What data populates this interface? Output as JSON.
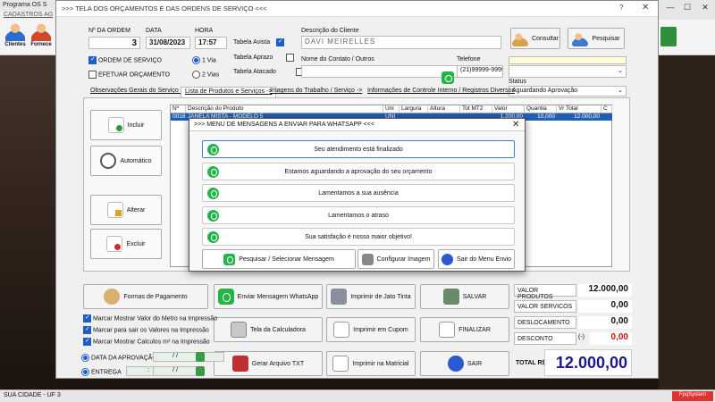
{
  "background_app": {
    "title": "Programa OS S",
    "menu": "CADASTROS   AG",
    "toolbar": [
      "Clientes",
      "Fornece"
    ],
    "status_left": "SUA CIDADE - UF 3",
    "brand": "FpqSystem"
  },
  "window": {
    "title": ">>>  TELA DOS ORÇAMENTOS E DAS ORDENS DE SERVIÇO  <<<",
    "help": "?",
    "close": "✕"
  },
  "order": {
    "num_label": "Nº DA ORDEM",
    "num": "3",
    "date_label": "DATA",
    "date": "31/08/2023",
    "time_label": "HORA",
    "time": "17:57"
  },
  "tables": {
    "avista": "Tabela Avista",
    "aprazo": "Tabela Aprazo",
    "atacado": "Tabela Atacado"
  },
  "type_options": {
    "ordem": "ORDEM DE SERVIÇO",
    "orcamento": "EFETUAR ORÇAMENTO",
    "via1": "1 Via",
    "via2": "2 Vias"
  },
  "client": {
    "desc_label": "Descrição do Cliente",
    "name": "DAVI MEIRELLES",
    "contact_label": "Nome do Contato / Outros",
    "contact": "",
    "phone_label": "Telefone",
    "phone": "(21)99999-9999",
    "consultar": "Consultar",
    "pesquisar": "Pesquisar"
  },
  "status": {
    "label": "Status",
    "value": "Aguardando Aprovação"
  },
  "tabs": [
    "Observações Gerais do Serviço ->",
    "Lista de Produtos e Serviços ->",
    "Imagens do Trabalho / Serviço ->",
    "Informações de Controle Interno / Registros Diversos"
  ],
  "side_buttons": {
    "incluir": "Incluir",
    "automatico": "Automático",
    "alterar": "Alterar",
    "excluir": "Excluir"
  },
  "grid": {
    "columns": [
      "Nº",
      "Descrição do Produto",
      "Uni",
      "Largura",
      "Altura",
      "Tot MT2",
      "Valor",
      "Quantia",
      "Vr Total",
      "C"
    ],
    "rows": [
      [
        "0016",
        "JANELA MISTA - MODELO 5",
        "UNI",
        "",
        "",
        "",
        "1.200,00",
        "10,000",
        "12.000,00",
        ""
      ]
    ]
  },
  "modal": {
    "title": ">>>  MENU DE MENSAGENS A ENVIAR PARA WHATSAPP  <<<",
    "close": "✕",
    "messages": [
      "Seu atendimento está finalizado",
      "Estamos aguardando a aprovação do seu orçamento",
      "Lamentamos a sua ausência",
      "Lamentamos o atraso",
      "Sua satisfação é nosso maior objetivo!"
    ],
    "search": "Pesquisar / Selecionar Mensagem",
    "config": "Configurar Imagem",
    "exit": "Sair do Menu Envio"
  },
  "bottom": {
    "formas": "Formas de Pagamento",
    "whatsapp": "Enviar Mensagem WhatsApp",
    "jato": "Imprimir de Jato Tinta",
    "salvar": "SALVAR",
    "calculadora": "Tela da Calculadora",
    "cupom": "Imprimir em Cupom",
    "finalizar": "FINALIZAR",
    "txt": "Gerar Arquivo TXT",
    "matricial": "Imprimir na Matricial",
    "sair": "SAIR",
    "chk1": "Marcar Mostrar Valor do Metro na Impressão",
    "chk2": "Marcar para sair os Valores na Impressão",
    "chk3": "Marcar Mostrar Calculos m² na Impressão",
    "data_aprovacao": "DATA DA APROVAÇÃO",
    "entrega": "ENTREGA",
    "date_placeholder": "/ /",
    "time_placeholder": ":"
  },
  "totals": {
    "produtos_label": "VALOR PRODUTOS",
    "produtos": "12.000,00",
    "servicos_label": "VALOR SERVICOS",
    "servicos": "0,00",
    "desloc_label": "DESLOCAMENTO",
    "desloc": "0,00",
    "desconto_label": "DESCONTO",
    "desconto_sign": "(-)",
    "desconto": "0,00",
    "total_label": "TOTAL R$",
    "total": "12.000,00"
  },
  "colors": {
    "accent": "#1b5fc4",
    "whatsapp": "#25b34a",
    "total": "#1a1a8c",
    "desconto": "#c01818"
  }
}
